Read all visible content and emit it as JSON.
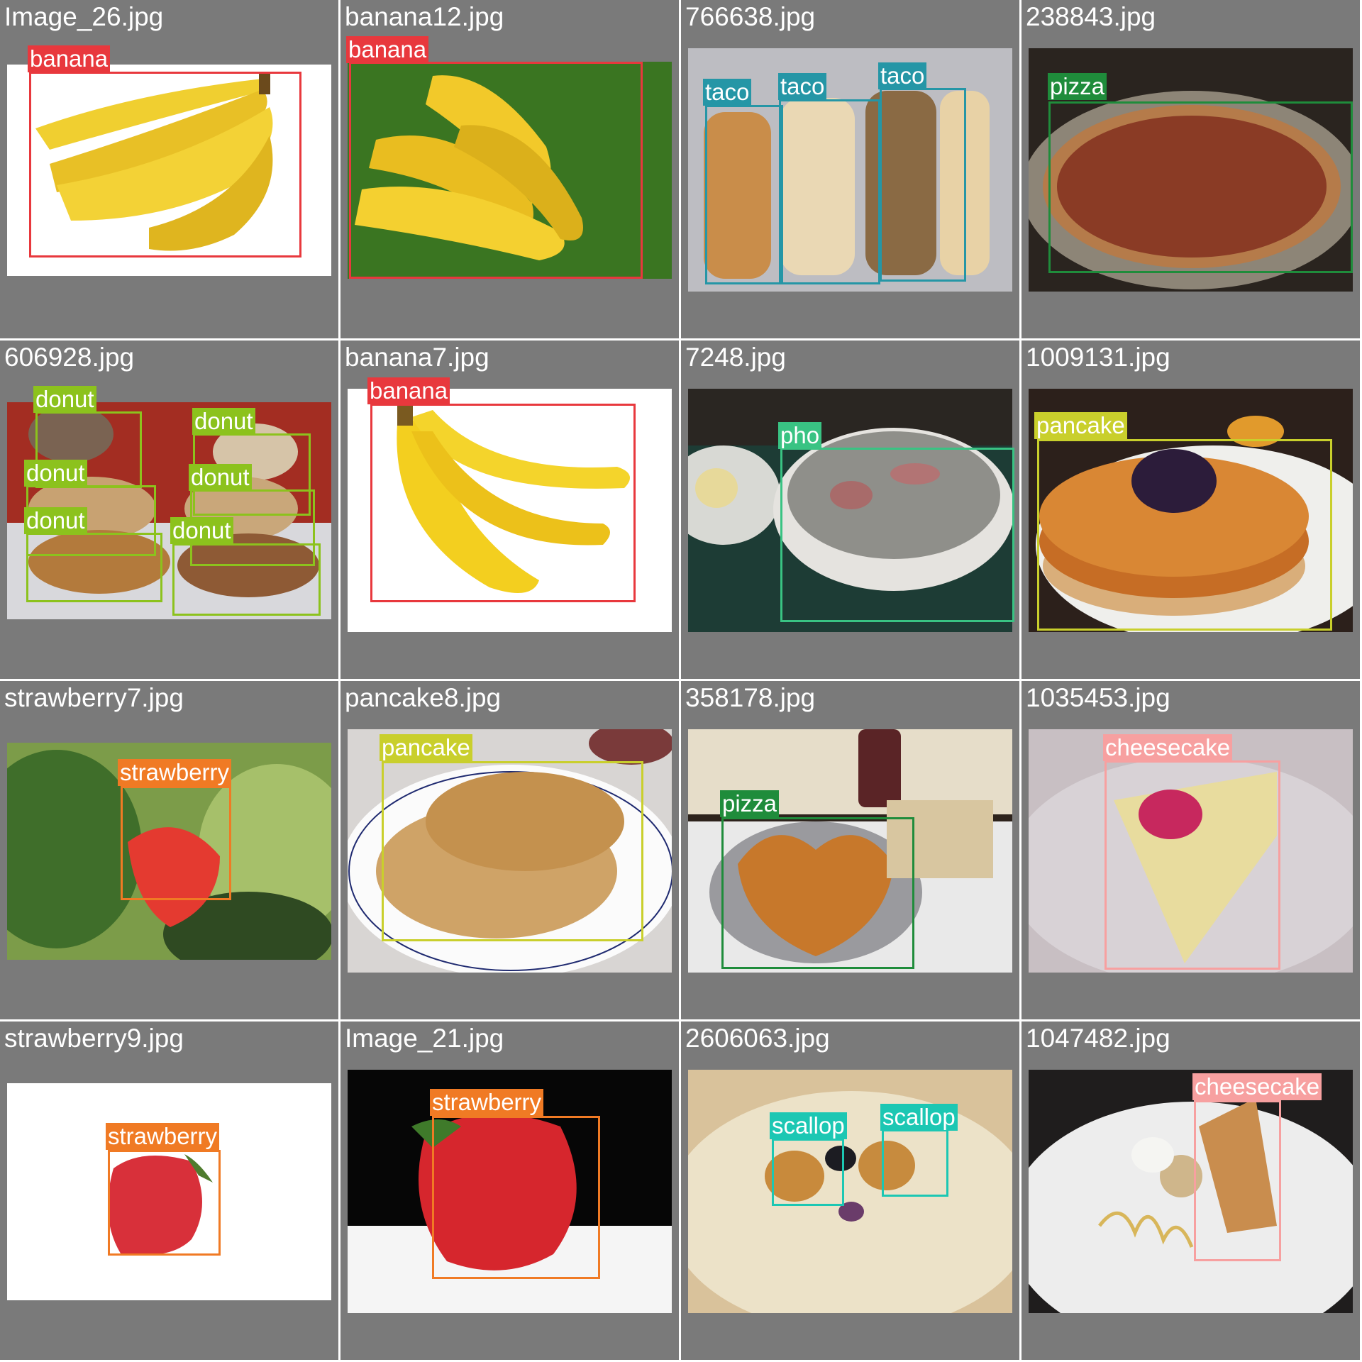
{
  "classes": {
    "banana": {
      "label": "banana",
      "color": "#e8383d"
    },
    "taco": {
      "label": "taco",
      "color": "#2596a6"
    },
    "pizza": {
      "label": "pizza",
      "color": "#1f8c3b"
    },
    "donut": {
      "label": "donut",
      "color": "#8cc21d"
    },
    "pho": {
      "label": "pho",
      "color": "#39c383"
    },
    "pancake": {
      "label": "pancake",
      "color": "#c9cf2c"
    },
    "strawberry": {
      "label": "strawberry",
      "color": "#f07a24"
    },
    "cheesecake": {
      "label": "cheesecake",
      "color": "#f7a0a0"
    },
    "scallop": {
      "label": "scallop",
      "color": "#1cc7b3"
    }
  },
  "tiles": [
    {
      "filename": "Image_26.jpg"
    },
    {
      "filename": "banana12.jpg"
    },
    {
      "filename": "766638.jpg"
    },
    {
      "filename": "238843.jpg"
    },
    {
      "filename": "606928.jpg"
    },
    {
      "filename": "banana7.jpg"
    },
    {
      "filename": "7248.jpg"
    },
    {
      "filename": "1009131.jpg"
    },
    {
      "filename": "strawberry7.jpg"
    },
    {
      "filename": "pancake8.jpg"
    },
    {
      "filename": "358178.jpg"
    },
    {
      "filename": "1035453.jpg"
    },
    {
      "filename": "strawberry9.jpg"
    },
    {
      "filename": "Image_21.jpg"
    },
    {
      "filename": "2606063.jpg"
    },
    {
      "filename": "1047482.jpg"
    }
  ]
}
